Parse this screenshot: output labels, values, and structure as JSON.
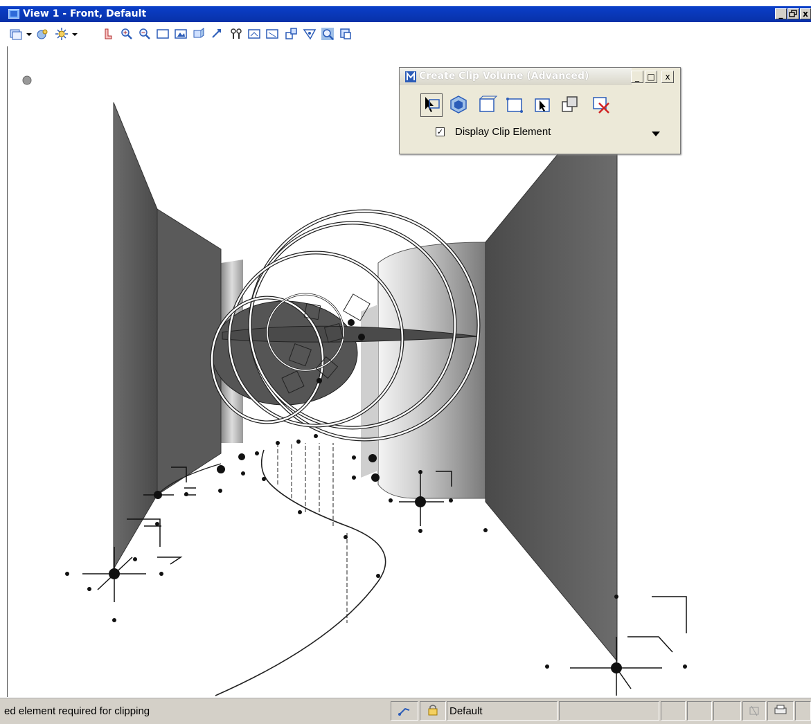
{
  "window": {
    "title": "View 1 - Front, Default",
    "controls": {
      "minimize": "_",
      "restore": "ð",
      "close": "x"
    }
  },
  "toolbar": {
    "icons": [
      "view-display-icon",
      "view-attributes-icon",
      "lighting-icon",
      "update-view-icon",
      "zoom-in-icon",
      "zoom-out-icon",
      "window-area-icon",
      "fit-view-icon",
      "view-rotate-icon",
      "pan-view-icon",
      "view-previous-icon",
      "view-next-icon",
      "copy-view-icon",
      "clip-volume-icon",
      "clip-mask-icon",
      "camera-icon",
      "change-view-perspective-icon"
    ]
  },
  "clip_dialog": {
    "title": "Create Clip Volume (Advanced)",
    "controls": {
      "minimize": "_",
      "maximize": "□",
      "close": "x"
    },
    "tools": [
      "clip-from-element-icon",
      "clip-from-named-boundary-icon",
      "clip-front-icon",
      "clip-back-icon",
      "select-clip-icon",
      "apply-clip-icon",
      "delete-clip-icon"
    ],
    "display_clip_element": {
      "label": "Display Clip Element",
      "checked": true,
      "check_mark": "✓"
    }
  },
  "statusbar": {
    "message": "ed element required for clipping",
    "level": "Default"
  },
  "colors": {
    "title_bar": "#0a3fc9",
    "chrome": "#d4d0c8",
    "dialog": "#ece9d8",
    "wall_dark": "#555555",
    "wall_light": "#d8d8d8"
  }
}
